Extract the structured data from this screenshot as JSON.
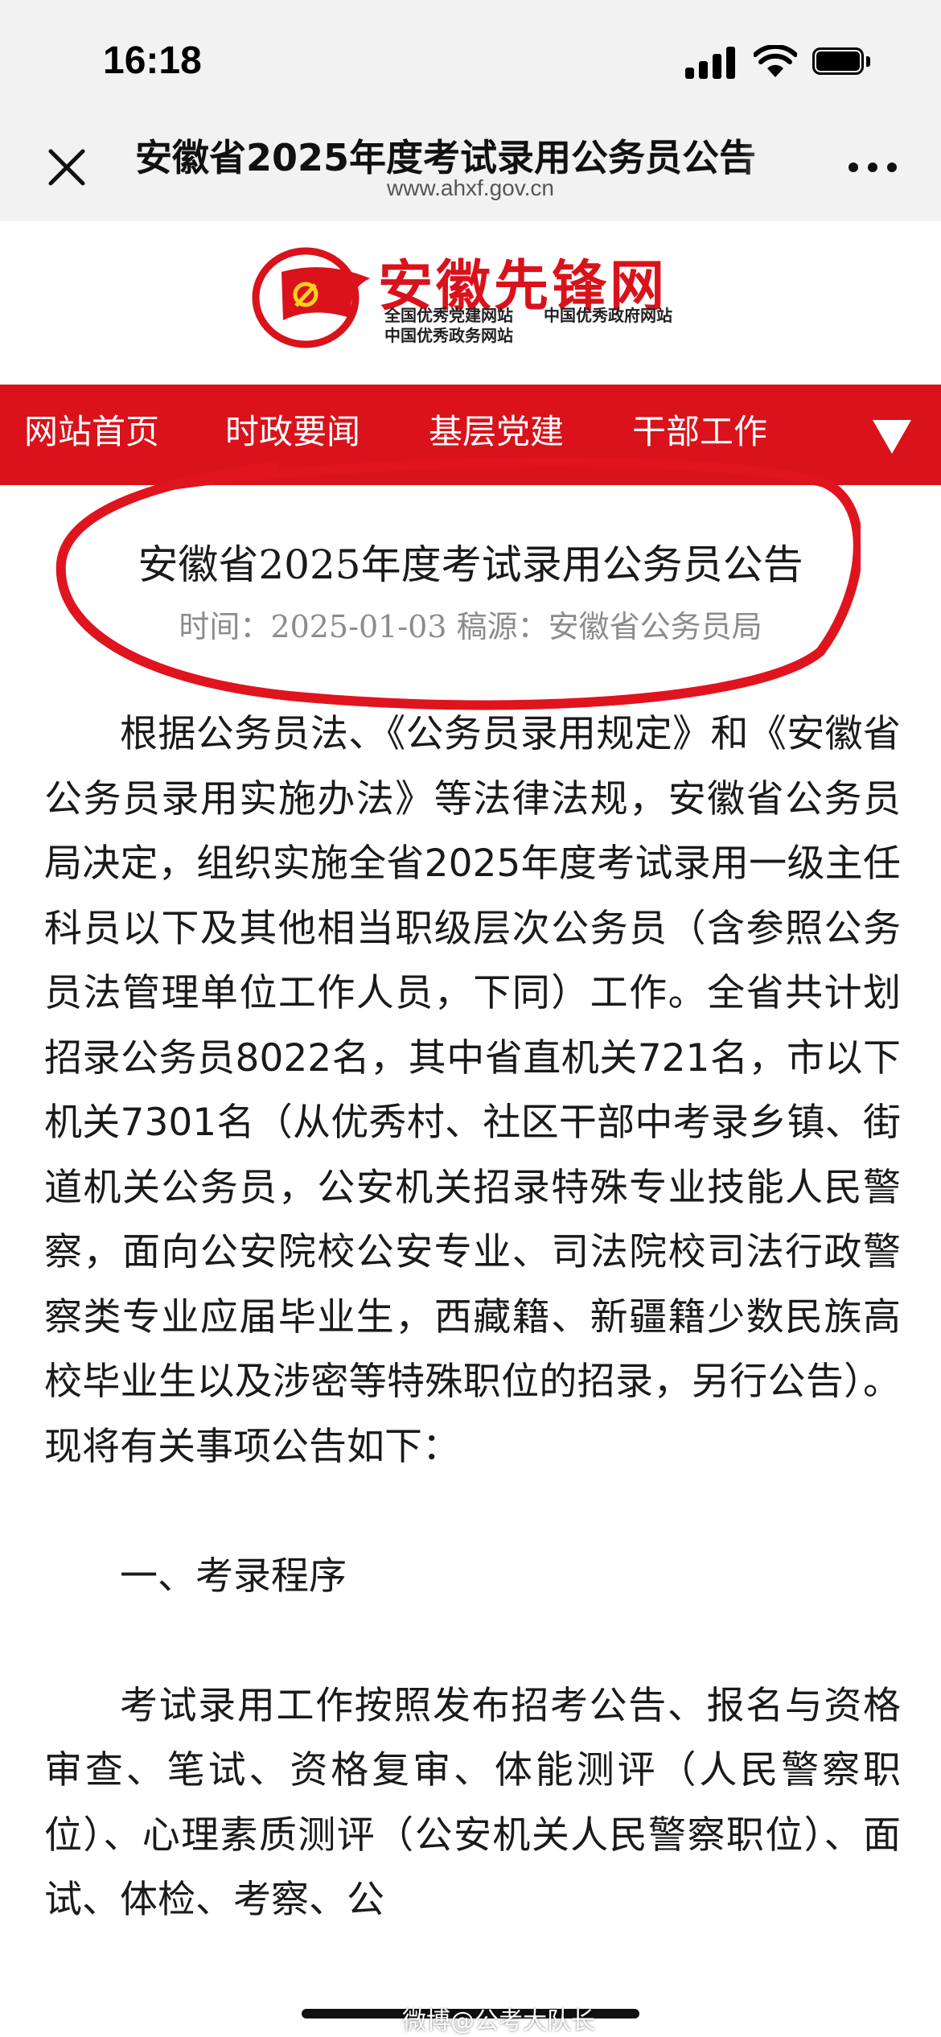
{
  "status_bar": {
    "time": "16:18"
  },
  "browser": {
    "title": "安徽省2025年度考试录用公务员公告",
    "url": "www.ahxf.gov.cn"
  },
  "site": {
    "name": "安徽先锋网",
    "tagline_1": "全国优秀党建网站",
    "tagline_2": "中国优秀政府网站",
    "tagline_3": "中国优秀政务网站",
    "brand_color": "#d9121b"
  },
  "nav": {
    "items": [
      "网站首页",
      "时政要闻",
      "基层党建",
      "干部工作"
    ]
  },
  "article": {
    "title": "安徽省2025年度考试录用公务员公告",
    "meta": "时间：2025-01-03 稿源：安徽省公务员局",
    "paragraphs": [
      "根据公务员法、《公务员录用规定》和《安徽省公务员录用实施办法》等法律法规，安徽省公务员局决定，组织实施全省2025年度考试录用一级主任科员以下及其他相当职级层次公务员（含参照公务员法管理单位工作人员，下同）工作。全省共计划招录公务员8022名，其中省直机关721名，市以下机关7301名（从优秀村、社区干部中考录乡镇、街道机关公务员，公安机关招录特殊专业技能人民警察，面向公安院校公安专业、司法院校司法行政警察类专业应届毕业生，西藏籍、新疆籍少数民族高校毕业生以及涉密等特殊职位的招录，另行公告）。现将有关事项公告如下：",
      "一、考录程序",
      "考试录用工作按照发布招考公告、报名与资格审查、笔试、资格复审、体能测评（人民警察职位）、心理素质测评（公安机关人民警察职位）、面试、体检、考察、公"
    ]
  },
  "watermark": "微博@公考大队长",
  "annotation_color": "#e0141e"
}
